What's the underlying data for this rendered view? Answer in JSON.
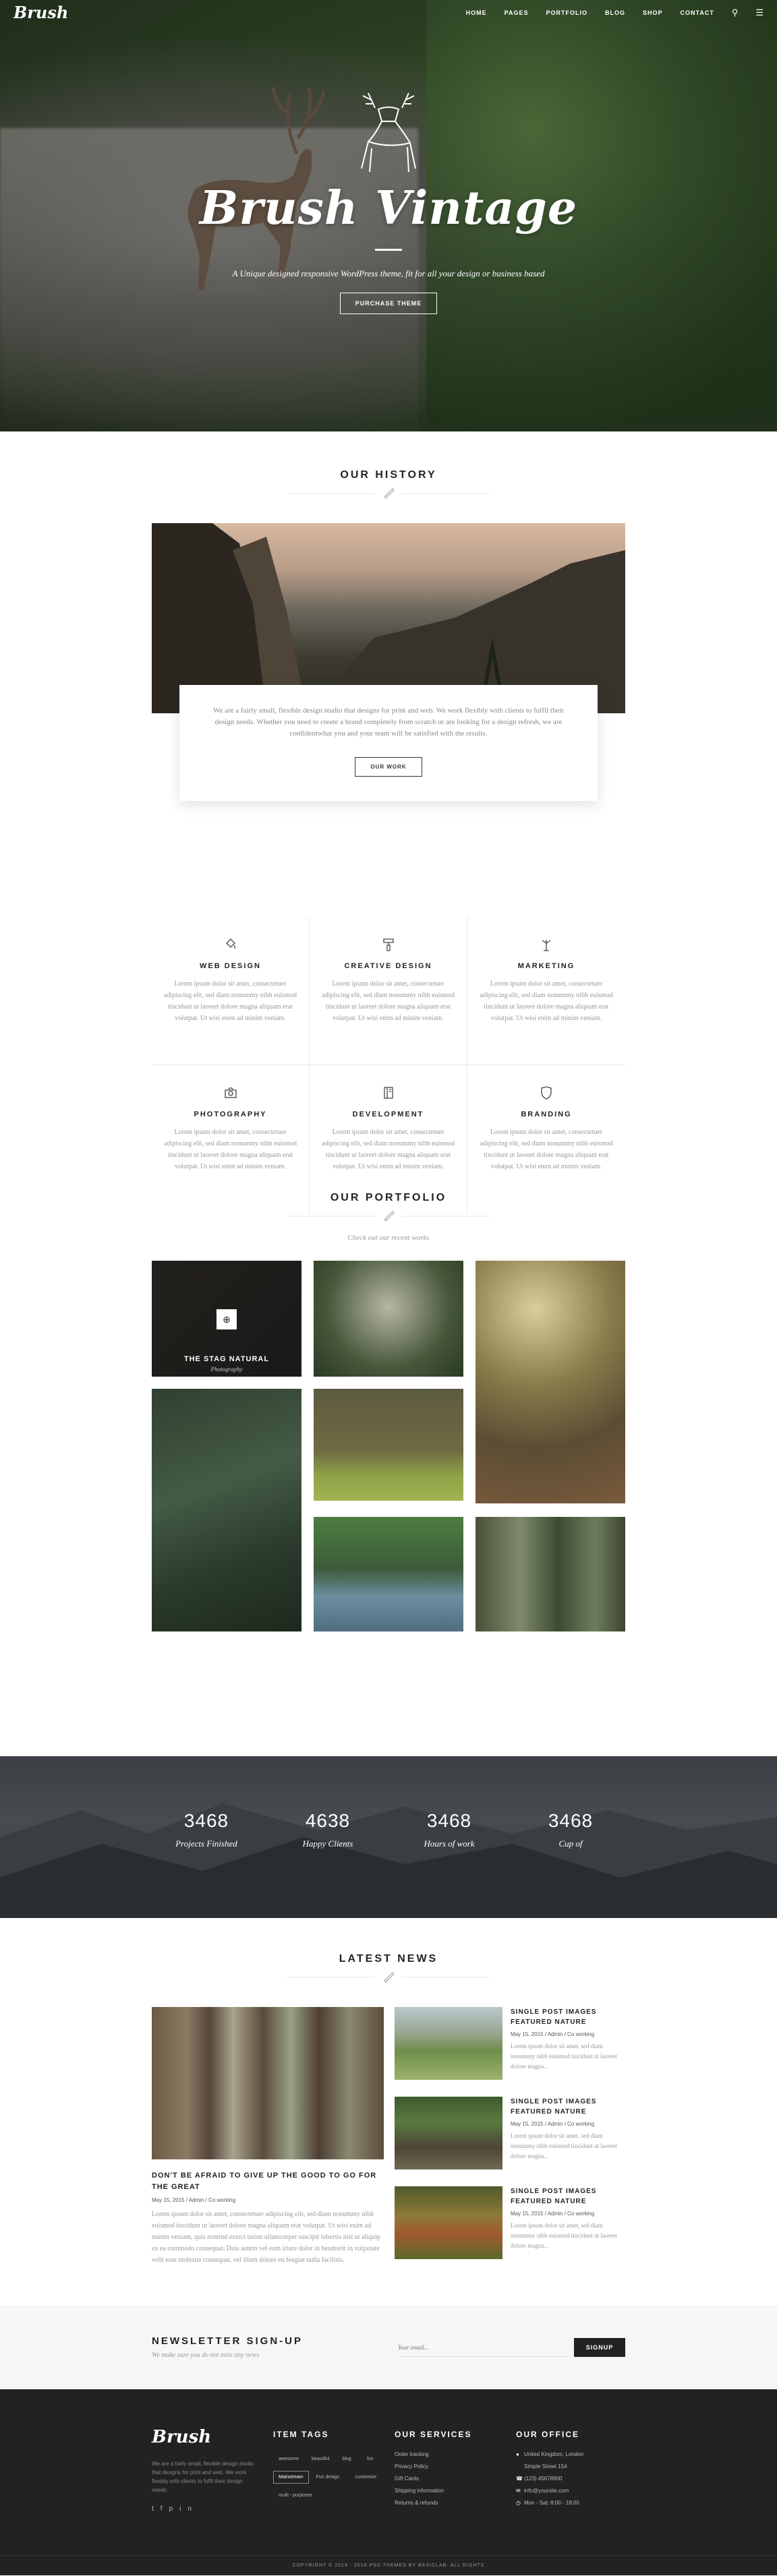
{
  "header": {
    "logo": "Brush",
    "nav": [
      "HOME",
      "PAGES",
      "PORTFOLIO",
      "BLOG",
      "SHOP",
      "CONTACT"
    ],
    "search_icon": "search-icon",
    "menu_icon": "hamburger-icon"
  },
  "hero": {
    "title": "Brush Vintage",
    "tagline": "A Unique designed responsive WordPress theme, fit for all your design or business based",
    "button": "PURCHASE THEME"
  },
  "history": {
    "title": "OUR HISTORY",
    "text": "We are a fairly small, flexible design studio that designs for print and web. We work flexibly with clients to fulfil their design needs. Whether you need to create a brand completely from scratch or are looking for a design refresh, we are confidentwhat you and your team will be satisfied with the results.",
    "button": "OUR WORK"
  },
  "services": [
    {
      "icon": "paint-bucket-icon",
      "title": "WEB DESIGN",
      "text": "Lorem ipsum dolor sit amet, consectetuer adipiscing elit, sed diam nonummy nibh euismod tincidunt ut laoreet dolore magna aliquam erat volutpat. Ut wisi enim ad minim veniam."
    },
    {
      "icon": "paint-roller-icon",
      "title": "CREATIVE DESIGN",
      "text": "Lorem ipsum dolor sit amet, consectetuer adipiscing elit, sed diam nonummy nibh euismod tincidunt ut laoreet dolore magna aliquam erat volutpat. Ut wisi enim ad minim veniam."
    },
    {
      "icon": "megaphone-icon",
      "title": "MARKETING",
      "text": "Lorem ipsum dolor sit amet, consectetuer adipiscing elit, sed diam nonummy nibh euismod tincidunt ut laoreet dolore magna aliquam erat volutpat. Ut wisi enim ad minim veniam."
    },
    {
      "icon": "camera-icon",
      "title": "PHOTOGRAPHY",
      "text": "Lorem ipsum dolor sit amet, consectetuer adipiscing elit, sed diam nonummy nibh euismod tincidunt ut laoreet dolore magna aliquam erat volutpat. Ut wisi enim ad minim veniam."
    },
    {
      "icon": "book-icon",
      "title": "DEVELOPMENT",
      "text": "Lorem ipsum dolor sit amet, consectetuer adipiscing elit, sed diam nonummy nibh euismod tincidunt ut laoreet dolore magna aliquam erat volutpat. Ut wisi enim ad minim veniam."
    },
    {
      "icon": "shield-icon",
      "title": "BRANDING",
      "text": "Lorem ipsum dolor sit amet, consectetuer adipiscing elit, sed diam nonummy nibh euismod tincidunt ut laoreet dolore magna aliquam erat volutpat. Ut wisi enim ad minim veniam."
    }
  ],
  "portfolio": {
    "title": "OUR PORTFOLIO",
    "subtitle": "Check out our recent works",
    "featured_title": "THE STAG NATURAL",
    "featured_category": "Photography",
    "zoom_icon": "zoom-icon"
  },
  "counters": [
    {
      "number": "3468",
      "label": "Projects Finished"
    },
    {
      "number": "4638",
      "label": "Happy Clients"
    },
    {
      "number": "3468",
      "label": "Hours of work"
    },
    {
      "number": "3468",
      "label": "Cup of"
    }
  ],
  "news": {
    "title": "LATEST NEWS",
    "featured": {
      "title": "DON'T BE AFRAID TO GIVE UP THE GOOD TO GO FOR THE GREAT",
      "meta": "May 15, 2015 / Admin / Co working",
      "text": "Lorem ipsum dolor sit amet, consectetuer adipiscing elit, sed diam nonummy nibh euismod tincidunt ut laoreet dolore magna aliquam erat volutpat. Ut wisi enim ad minim veniam, quis nostrud exerci tation ullamcorper suscipit lobortis nisl ut aliquip ex ea commodo consequat. Duis autem vel eum iriure dolor in hendrerit in vulputate velit esse molestie consequat, vel illum dolore eu feugiat nulla facilisis."
    },
    "posts": [
      {
        "title": "SINGLE POST IMAGES FEATURED NATURE",
        "meta": "May 15, 2015 / Admin / Co working",
        "text": "Lorem ipsum dolor sit amet, sed diam nonummy nibh euismod tincidunt ut laoreet dolore magna..."
      },
      {
        "title": "SINGLE POST IMAGES FEATURED NATURE",
        "meta": "May 15, 2015 / Admin / Co working",
        "text": "Lorem ipsum dolor sit amet, sed diam nonummy nibh euismod tincidunt ut laoreet dolore magna..."
      },
      {
        "title": "SINGLE POST IMAGES FEATURED NATURE",
        "meta": "May 15, 2015 / Admin / Co working",
        "text": "Lorem ipsum dolor sit amet, sed diam nonummy nibh euismod tincidunt ut laoreet dolore magna..."
      }
    ]
  },
  "newsletter": {
    "title": "NEWSLETTER SIGN-UP",
    "subtitle": "We make sure you do not miss any news",
    "placeholder": "Your email...",
    "button": "SIGNUP"
  },
  "footer": {
    "logo": "Brush",
    "about": "We are a fairly small, flexible design studio that designs for print and web. We work flexibly with clients to fulfil their design needs.",
    "social": [
      "twitter-icon",
      "facebook-icon",
      "pinterest-icon",
      "linkedin-icon"
    ],
    "tags_title": "ITEM TAGS",
    "tags": [
      "awesome",
      "beautiful",
      "blog",
      "fox",
      "Mainstream",
      "Fun design",
      "customize",
      "multi - purposes"
    ],
    "services_title": "OUR SERVICES",
    "services": [
      "Order tracking",
      "Privacy Policy",
      "Gift Cards",
      "Shipping information",
      "Returns & refunds"
    ],
    "office_title": "OUR OFFICE",
    "office": [
      "United Kingdom, London",
      "Simple Street 154",
      "(123) 45678900",
      "info@yoursite.com",
      "Mon - Sat: 8:00 - 18:00"
    ],
    "copyright": "COPYRIGHT © 2014 - 2016 PSD THEMES BY BASICLAB. ALL RIGHTS"
  }
}
